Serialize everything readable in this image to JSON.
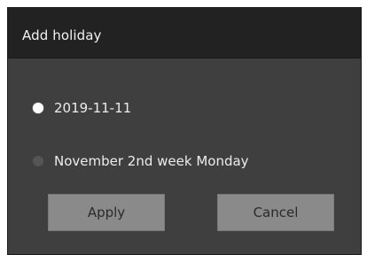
{
  "dialog": {
    "title": "Add holiday",
    "options": [
      {
        "label": "2019-11-11",
        "selected": true
      },
      {
        "label": "November 2nd week Monday",
        "selected": false
      }
    ],
    "buttons": {
      "apply_label": "Apply",
      "cancel_label": "Cancel"
    }
  },
  "colors": {
    "dialog_background": "#3f3f3f",
    "titlebar_background": "#222222",
    "button_background": "#8a8a8a",
    "text": "#ececec"
  }
}
